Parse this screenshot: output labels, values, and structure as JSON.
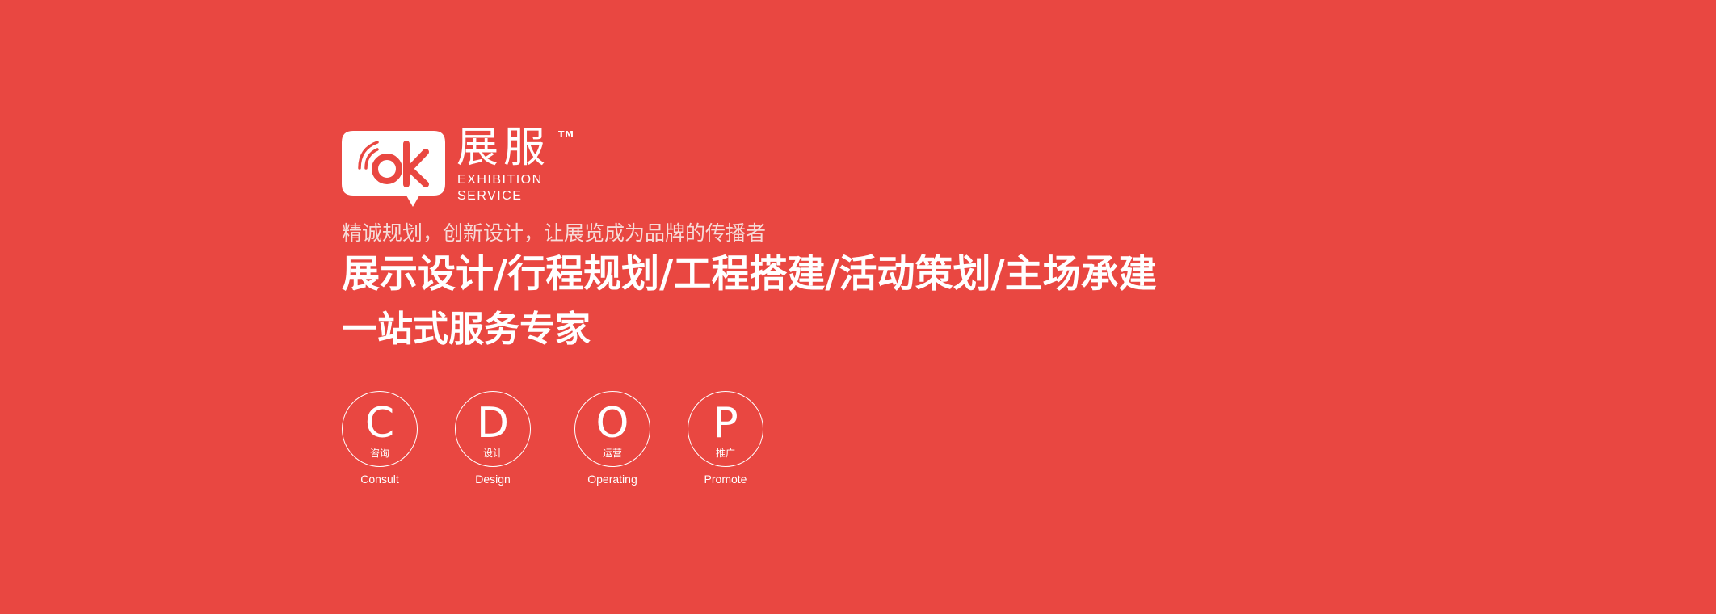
{
  "brand": {
    "name_cn": "展服",
    "name_en_line1": "EXHIBITION",
    "name_en_line2": "SERVICE",
    "trademark": "TM",
    "logo_icon": "speech-bubble-ok-icon",
    "logo_text": "ok",
    "color_primary": "#E94741",
    "color_text": "#FFFFFF"
  },
  "tagline": "精诚规划，创新设计，让展览成为品牌的传播者",
  "services_line": "展示设计/行程规划/工程搭建/活动策划/主场承建",
  "slogan": "一站式服务专家",
  "pillars": [
    {
      "letter": "C",
      "cn": "咨询",
      "en": "Consult"
    },
    {
      "letter": "D",
      "cn": "设计",
      "en": "Design"
    },
    {
      "letter": "O",
      "cn": "运营",
      "en": "Operating"
    },
    {
      "letter": "P",
      "cn": "推广",
      "en": "Promote"
    }
  ]
}
